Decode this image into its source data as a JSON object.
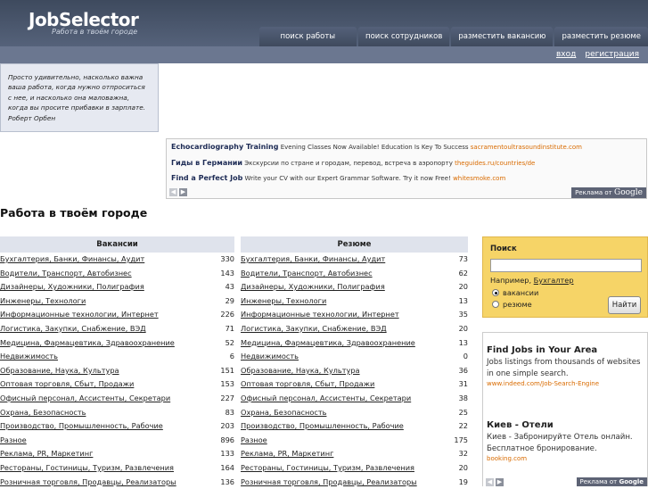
{
  "header": {
    "logo": "JobSelector",
    "slogan": "Работа в твоём городе",
    "nav": [
      "поиск работы",
      "поиск сотрудников",
      "разместить вакансию",
      "разместить резюме"
    ]
  },
  "auth": {
    "login": "вход",
    "register": "регистрация"
  },
  "quote": {
    "text": "Просто удивительно, насколько важна ваша работа, когда нужно отпроситься с нее, и насколько она маловажна, когда вы просите прибавки в зарплате.",
    "author": "Роберт Орбен"
  },
  "top_ads": [
    {
      "title": "Echocardiography Training",
      "text": "Evening Classes Now Available! Education Is Key To Success",
      "url": "sacramentoultrasoundinstitute.com"
    },
    {
      "title": "Гиды в Германии",
      "text": "Экскурсии по стране и городам, перевод, встреча в аэропорту",
      "url": "theguides.ru/countries/de"
    },
    {
      "title": "Find a Perfect Job",
      "text": "Write your CV with our Expert Grammar Software. Try it now Free!",
      "url": "whitesmoke.com"
    }
  ],
  "ads_badge": {
    "prefix": "Реклама от",
    "brand": "Google"
  },
  "section_title": "Работа в твоём городе",
  "vacancies": {
    "header": "Вакансии",
    "rows": [
      {
        "name": "Бухгалтерия, Банки, Финансы, Аудит",
        "count": "330"
      },
      {
        "name": "Водители, Транспорт, Автобизнес",
        "count": "143"
      },
      {
        "name": "Дизайнеры, Художники, Полиграфия",
        "count": "43"
      },
      {
        "name": "Инженеры, Технологи",
        "count": "29"
      },
      {
        "name": "Информационные технологии, Интернет",
        "count": "226"
      },
      {
        "name": "Логистика, Закупки, Снабжение, ВЭД",
        "count": "71"
      },
      {
        "name": "Медицина, Фармацевтика, Здравоохранение",
        "count": "52"
      },
      {
        "name": "Недвижимость",
        "count": "6"
      },
      {
        "name": "Образование, Наука, Культура",
        "count": "151"
      },
      {
        "name": "Оптовая торговля, Сбыт, Продажи",
        "count": "153"
      },
      {
        "name": "Офисный персонал, Ассистенты, Секретари",
        "count": "227"
      },
      {
        "name": "Охрана, Безопасность",
        "count": "83"
      },
      {
        "name": "Производство, Промышленность, Рабочие",
        "count": "203"
      },
      {
        "name": "Разное",
        "count": "896"
      },
      {
        "name": "Реклама, PR, Маркетинг",
        "count": "133"
      },
      {
        "name": "Рестораны, Гостиницы, Туризм, Развлечения",
        "count": "164"
      },
      {
        "name": "Розничная торговля, Продавцы, Реализаторы",
        "count": "136"
      }
    ]
  },
  "resumes": {
    "header": "Резюме",
    "rows": [
      {
        "name": "Бухгалтерия, Банки, Финансы, Аудит",
        "count": "73"
      },
      {
        "name": "Водители, Транспорт, Автобизнес",
        "count": "62"
      },
      {
        "name": "Дизайнеры, Художники, Полиграфия",
        "count": "20"
      },
      {
        "name": "Инженеры, Технологи",
        "count": "13"
      },
      {
        "name": "Информационные технологии, Интернет",
        "count": "35"
      },
      {
        "name": "Логистика, Закупки, Снабжение, ВЭД",
        "count": "20"
      },
      {
        "name": "Медицина, Фармацевтика, Здравоохранение",
        "count": "13"
      },
      {
        "name": "Недвижимость",
        "count": "0"
      },
      {
        "name": "Образование, Наука, Культура",
        "count": "36"
      },
      {
        "name": "Оптовая торговля, Сбыт, Продажи",
        "count": "31"
      },
      {
        "name": "Офисный персонал, Ассистенты, Секретари",
        "count": "38"
      },
      {
        "name": "Охрана, Безопасность",
        "count": "25"
      },
      {
        "name": "Производство, Промышленность, Рабочие",
        "count": "22"
      },
      {
        "name": "Разное",
        "count": "175"
      },
      {
        "name": "Реклама, PR, Маркетинг",
        "count": "32"
      },
      {
        "name": "Рестораны, Гостиницы, Туризм, Развлечения",
        "count": "20"
      },
      {
        "name": "Розничная торговля, Продавцы, Реализаторы",
        "count": "19"
      }
    ]
  },
  "search": {
    "title": "Поиск",
    "example_prefix": "Например,",
    "example_link": "Бухгалтер",
    "option_vacancies": "вакансии",
    "option_resumes": "резюме",
    "button": "Найти"
  },
  "side_ads": [
    {
      "title": "Find Jobs in Your Area",
      "text": "Jobs listings from thousands of websites in one simple search.",
      "url": "www.indeed.com/Job-Search-Engine"
    },
    {
      "title": "Киев - Отели",
      "text": "Киев - Забронируйте Отель онлайн. Бесплатное бронирование.",
      "url": "booking.com"
    }
  ],
  "colors": {
    "header": "#3e4a5e",
    "subbar": "#6b7790",
    "search_bg": "#f6d467",
    "ad_url": "#d96b00",
    "table_head": "#dfe3ec"
  }
}
